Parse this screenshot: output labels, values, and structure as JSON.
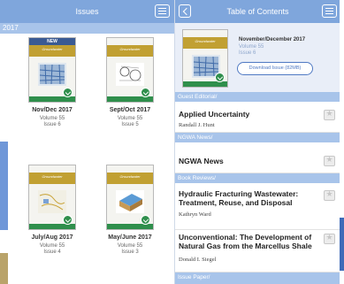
{
  "left_panel": {
    "title": "Issues",
    "section": "2017",
    "issues": [
      {
        "new_label": "NEW",
        "brand": "Groundwater",
        "name": "Nov/Dec 2017",
        "volume": "Volume 55",
        "issue": "Issue 6"
      },
      {
        "new_label": "",
        "brand": "Groundwater",
        "name": "Sept/Oct 2017",
        "volume": "Volume 55",
        "issue": "Issue 5"
      },
      {
        "new_label": "",
        "brand": "Groundwater",
        "name": "July/Aug 2017",
        "volume": "Volume 55",
        "issue": "Issue 4"
      },
      {
        "new_label": "",
        "brand": "Groundwater",
        "name": "May/June 2017",
        "volume": "Volume 55",
        "issue": "Issue 3"
      }
    ]
  },
  "right_panel": {
    "title": "Table of Contents",
    "current_issue": {
      "brand": "Groundwater",
      "date": "November/December 2017",
      "volume": "Volume 55",
      "issue": "Issue 6",
      "download_label": "Download Issue (82MB)"
    },
    "sections": [
      {
        "name": "Guest Editorial/",
        "articles": [
          {
            "title": "Applied Uncertainty",
            "author": "Randall J. Hunt"
          }
        ]
      },
      {
        "name": "NGWA News/",
        "articles": [
          {
            "title": "NGWA News",
            "author": ""
          }
        ]
      },
      {
        "name": "Book Reviews/",
        "articles": [
          {
            "title": "Hydraulic Fracturing Wastewater: Treatment, Reuse, and Disposal",
            "author": "Kathryn Ward"
          },
          {
            "title": "Unconventional: The Development of Natural Gas from the Marcellus Shale",
            "author": "Donald I. Siegel"
          }
        ]
      },
      {
        "name": "Issue Paper/",
        "articles": []
      }
    ]
  },
  "colors": {
    "nav_bar": "#7fa6dc",
    "section_bar": "#a8c4ea",
    "accent": "#4f79c3",
    "cover_band": "#c1a032",
    "cover_green": "#2f8f4c"
  },
  "icons": [
    "menu-icon",
    "back-chevron-icon",
    "star-icon",
    "checkmark-badge-icon"
  ]
}
